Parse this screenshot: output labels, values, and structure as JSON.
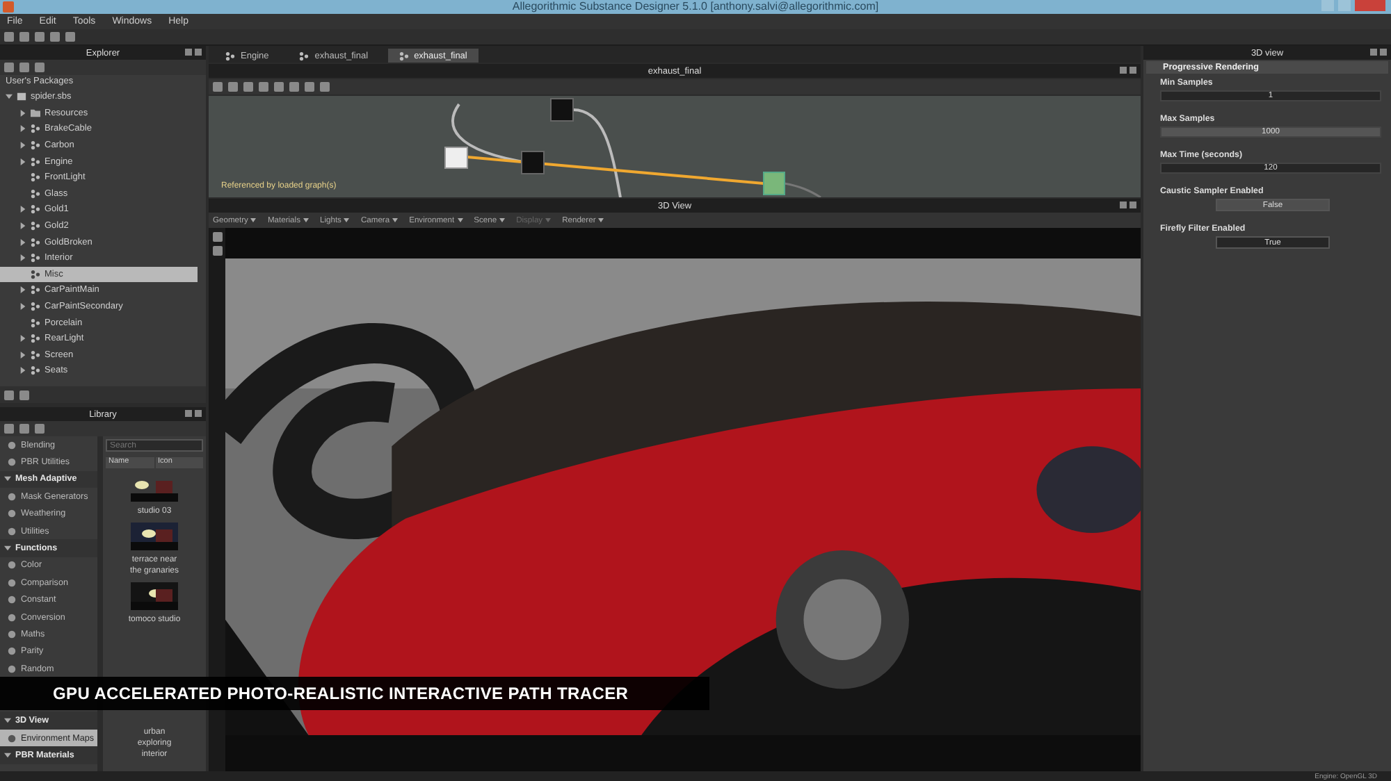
{
  "window": {
    "title": "Allegorithmic Substance Designer 5.1.0 [anthony.salvi@allegorithmic.com]"
  },
  "menu": [
    "File",
    "Edit",
    "Tools",
    "Windows",
    "Help"
  ],
  "explorer": {
    "title": "Explorer",
    "root_label": "User's Packages",
    "package": {
      "label": "spider.sbs",
      "expanded": true,
      "children": [
        {
          "label": "Resources",
          "kind": "folder",
          "expandable": true,
          "selected": false
        },
        {
          "label": "BrakeCable",
          "kind": "graph",
          "expandable": true,
          "selected": false
        },
        {
          "label": "Carbon",
          "kind": "graph",
          "expandable": true,
          "selected": false
        },
        {
          "label": "Engine",
          "kind": "graph",
          "expandable": true,
          "selected": false
        },
        {
          "label": "FrontLight",
          "kind": "graph",
          "expandable": false,
          "selected": false
        },
        {
          "label": "Glass",
          "kind": "graph",
          "expandable": false,
          "selected": false
        },
        {
          "label": "Gold1",
          "kind": "graph",
          "expandable": true,
          "selected": false
        },
        {
          "label": "Gold2",
          "kind": "graph",
          "expandable": true,
          "selected": false
        },
        {
          "label": "GoldBroken",
          "kind": "graph",
          "expandable": true,
          "selected": false
        },
        {
          "label": "Interior",
          "kind": "graph",
          "expandable": true,
          "selected": false
        },
        {
          "label": "Misc",
          "kind": "graph",
          "expandable": false,
          "selected": true
        },
        {
          "label": "CarPaintMain",
          "kind": "graph",
          "expandable": true,
          "selected": false
        },
        {
          "label": "CarPaintSecondary",
          "kind": "graph",
          "expandable": true,
          "selected": false
        },
        {
          "label": "Porcelain",
          "kind": "graph",
          "expandable": false,
          "selected": false
        },
        {
          "label": "RearLight",
          "kind": "graph",
          "expandable": true,
          "selected": false
        },
        {
          "label": "Screen",
          "kind": "graph",
          "expandable": true,
          "selected": false
        },
        {
          "label": "Seats",
          "kind": "graph",
          "expandable": true,
          "selected": false
        }
      ]
    }
  },
  "library": {
    "title": "Library",
    "categories": [
      {
        "label": "Blending",
        "kind": "item",
        "selected": false
      },
      {
        "label": "PBR Utilities",
        "kind": "item",
        "selected": false
      },
      {
        "label": "Mesh Adaptive",
        "kind": "header",
        "selected": false
      },
      {
        "label": "Mask Generators",
        "kind": "item",
        "selected": false
      },
      {
        "label": "Weathering",
        "kind": "item",
        "selected": false
      },
      {
        "label": "Utilities",
        "kind": "item",
        "selected": false
      },
      {
        "label": "Functions",
        "kind": "header",
        "selected": false
      },
      {
        "label": "Color",
        "kind": "item",
        "selected": false
      },
      {
        "label": "Comparison",
        "kind": "item",
        "selected": false
      },
      {
        "label": "Constant",
        "kind": "item",
        "selected": false
      },
      {
        "label": "Conversion",
        "kind": "item",
        "selected": false
      },
      {
        "label": "Maths",
        "kind": "item",
        "selected": false
      },
      {
        "label": "Parity",
        "kind": "item",
        "selected": false
      },
      {
        "label": "Random",
        "kind": "item",
        "selected": false
      }
    ],
    "categories_below_caption": [
      {
        "label": "3D View",
        "kind": "header",
        "selected": false
      },
      {
        "label": "Environment Maps",
        "kind": "item",
        "selected": true
      },
      {
        "label": "PBR Materials",
        "kind": "header",
        "selected": false
      }
    ],
    "search": {
      "placeholder": "Search"
    },
    "columns": [
      "Name",
      "Icon"
    ],
    "thumbnails": [
      {
        "label": "studio 03"
      },
      {
        "label": "terrace near the granaries"
      },
      {
        "label": "tomoco studio"
      }
    ],
    "thumbnails_below_caption": [
      {
        "label": "urban exploring interior"
      }
    ]
  },
  "tabs": [
    {
      "label": "Engine",
      "selected": false
    },
    {
      "label": "exhaust_final",
      "selected": false
    },
    {
      "label": "exhaust_final",
      "selected": true
    }
  ],
  "graph": {
    "title": "exhaust_final",
    "note": "Referenced by loaded graph(s)"
  },
  "view3d": {
    "title": "3D View",
    "menus": [
      {
        "label": "Geometry",
        "disabled": false
      },
      {
        "label": "Materials",
        "disabled": false
      },
      {
        "label": "Lights",
        "disabled": false
      },
      {
        "label": "Camera",
        "disabled": false
      },
      {
        "label": "Environment",
        "disabled": false
      },
      {
        "label": "Scene",
        "disabled": false
      },
      {
        "label": "Display",
        "disabled": true
      },
      {
        "label": "Renderer",
        "disabled": false
      }
    ]
  },
  "properties": {
    "title": "3D view",
    "section": "Progressive Rendering",
    "fields": [
      {
        "label": "Min Samples",
        "kind": "number",
        "value": "1"
      },
      {
        "label": "Max Samples",
        "kind": "number",
        "value": "1000"
      },
      {
        "label": "Max Time (seconds)",
        "kind": "number",
        "value": "120"
      },
      {
        "label": "Caustic Sampler Enabled",
        "kind": "toggle",
        "value": "False",
        "on": false
      },
      {
        "label": "Firefly Filter Enabled",
        "kind": "toggle",
        "value": "True",
        "on": true
      }
    ]
  },
  "caption": "GPU ACCELERATED PHOTO-REALISTIC INTERACTIVE PATH TRACER",
  "status_bar": {
    "text": "Engine: OpenGL 3D"
  }
}
